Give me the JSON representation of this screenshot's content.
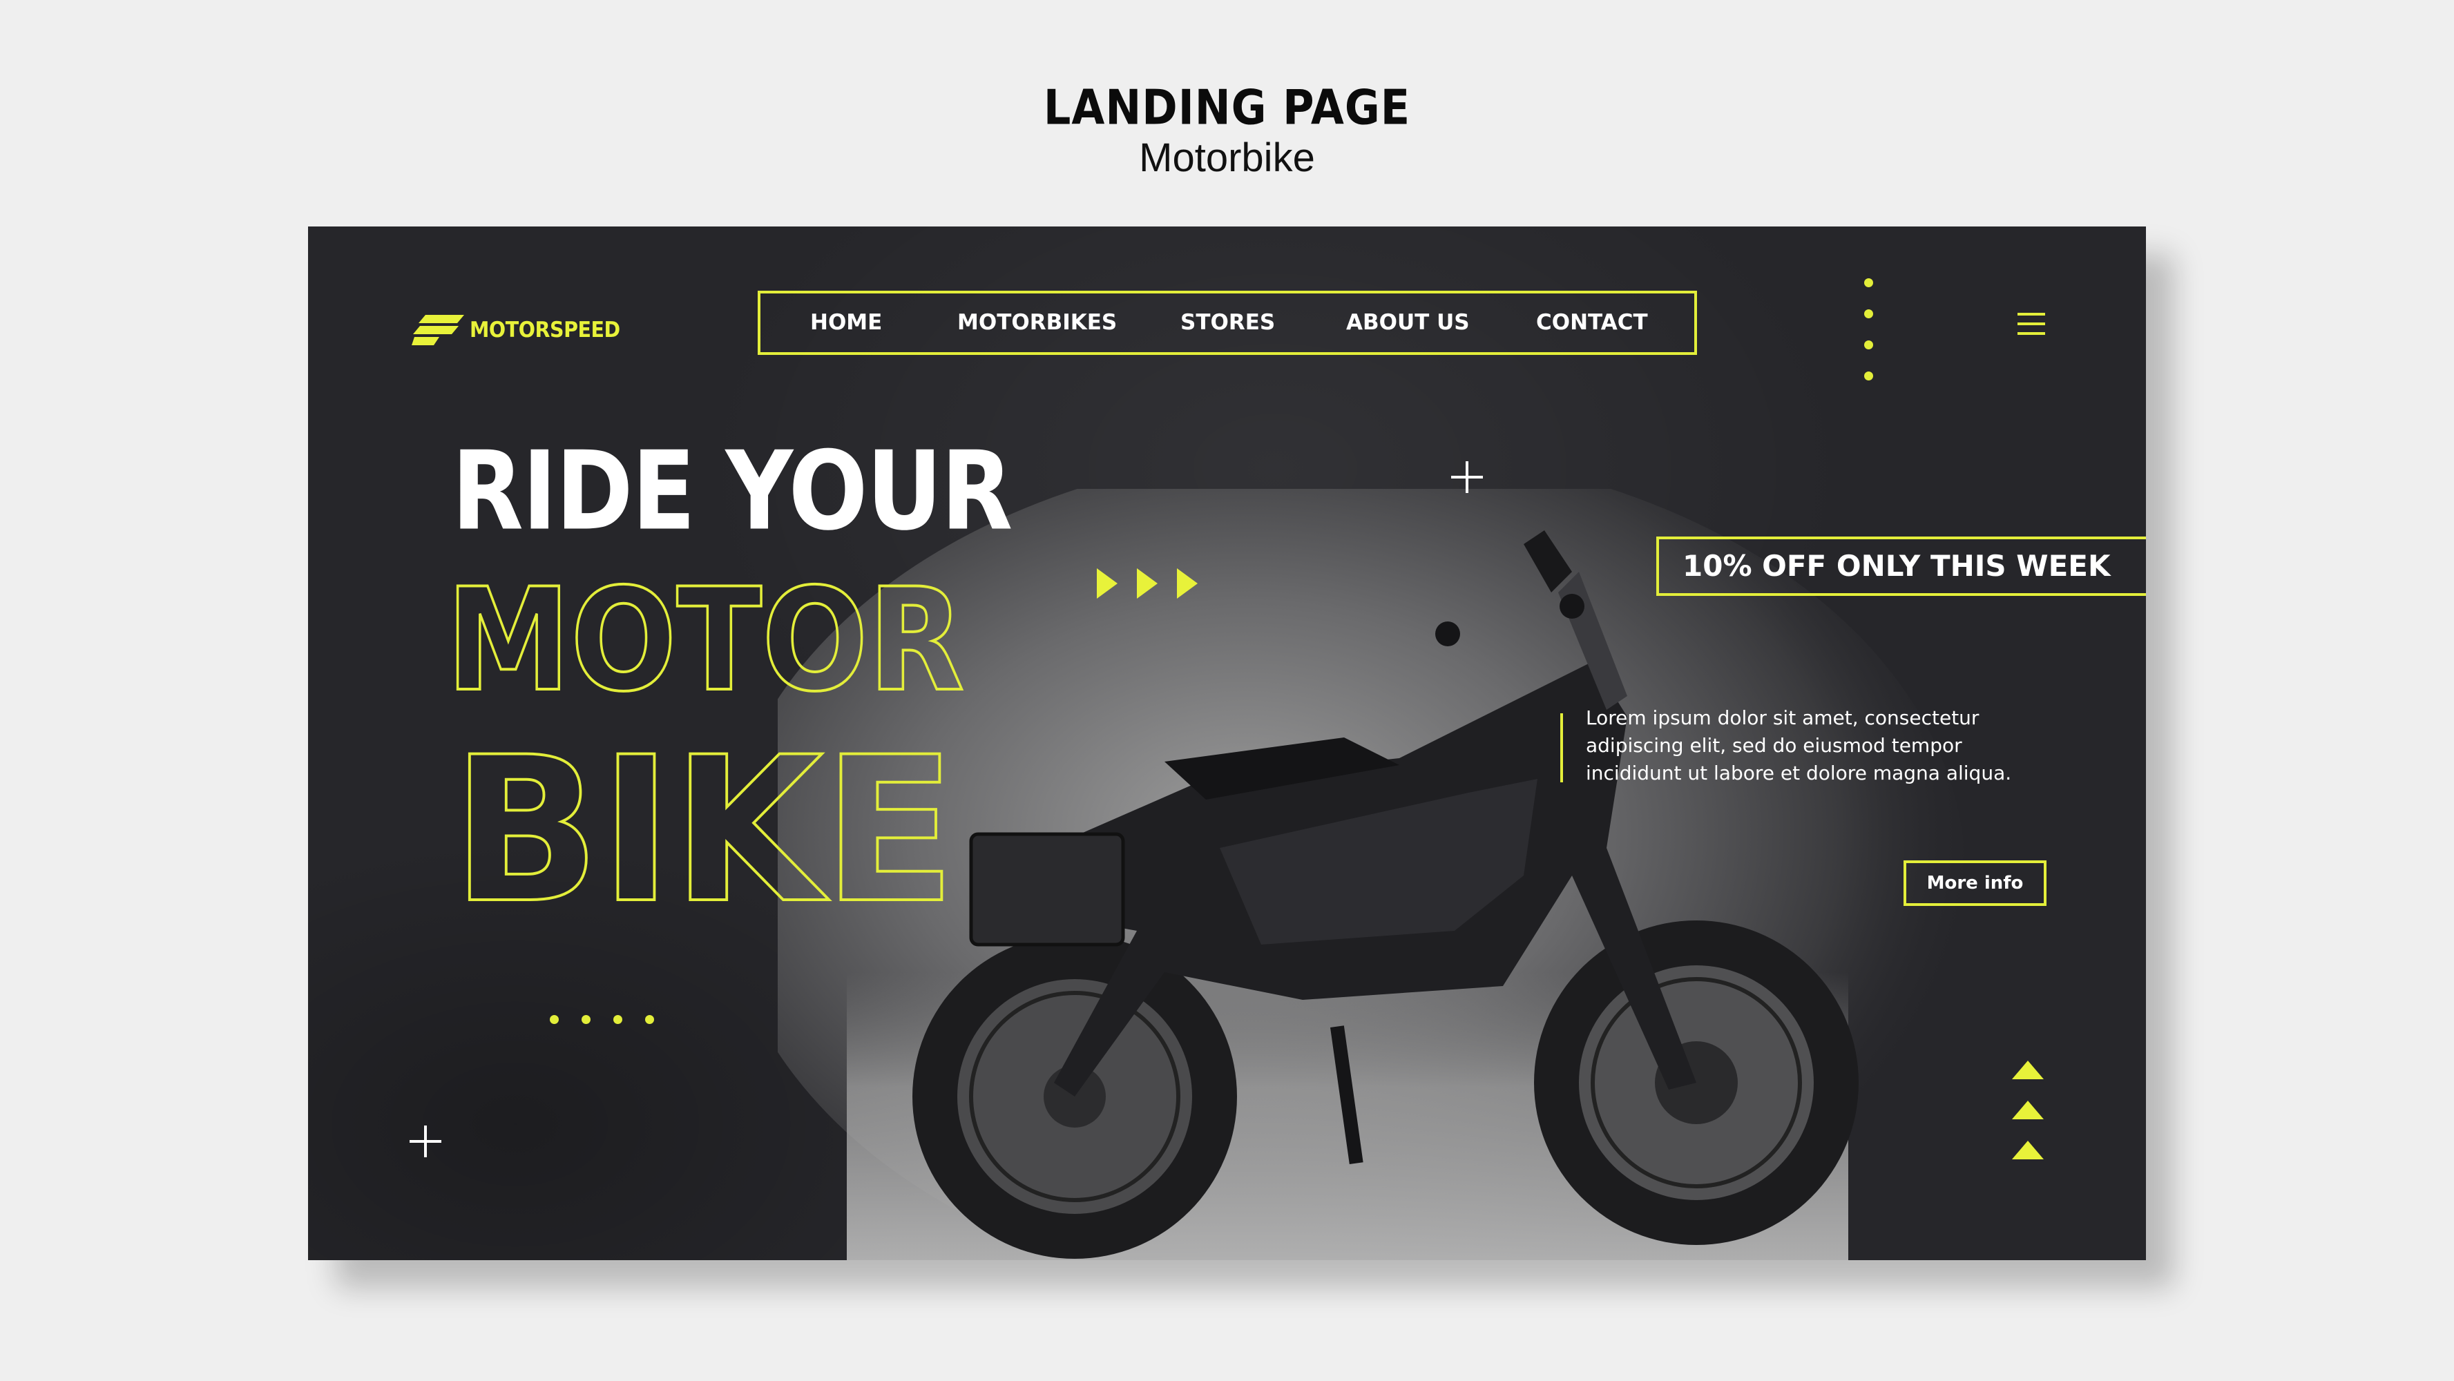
{
  "header": {
    "title": "LANDING PAGE",
    "subtitle": "Motorbike"
  },
  "brand": {
    "name": "MOTORSPEED",
    "accent_color": "#e8f23a",
    "background": "#26262a"
  },
  "nav": {
    "items": [
      "HOME",
      "MOTORBIKES",
      "STORES",
      "ABOUT US",
      "CONTACT"
    ]
  },
  "hero": {
    "line1": "RIDE YOUR",
    "line2": "MOTOR",
    "line3": "BIKE"
  },
  "promo": {
    "text": "10% OFF ONLY THIS WEEK"
  },
  "description": {
    "line1": "Lorem ipsum dolor sit amet, consectetur",
    "line2": "adipiscing elit, sed do eiusmod tempor",
    "line3": "incididunt ut labore et dolore magna aliqua."
  },
  "cta": {
    "label": "More info"
  },
  "icons": [
    "logo-icon",
    "menu-icon",
    "plus-icon",
    "play-arrow-icon",
    "up-arrow-icon",
    "dots-icon"
  ]
}
